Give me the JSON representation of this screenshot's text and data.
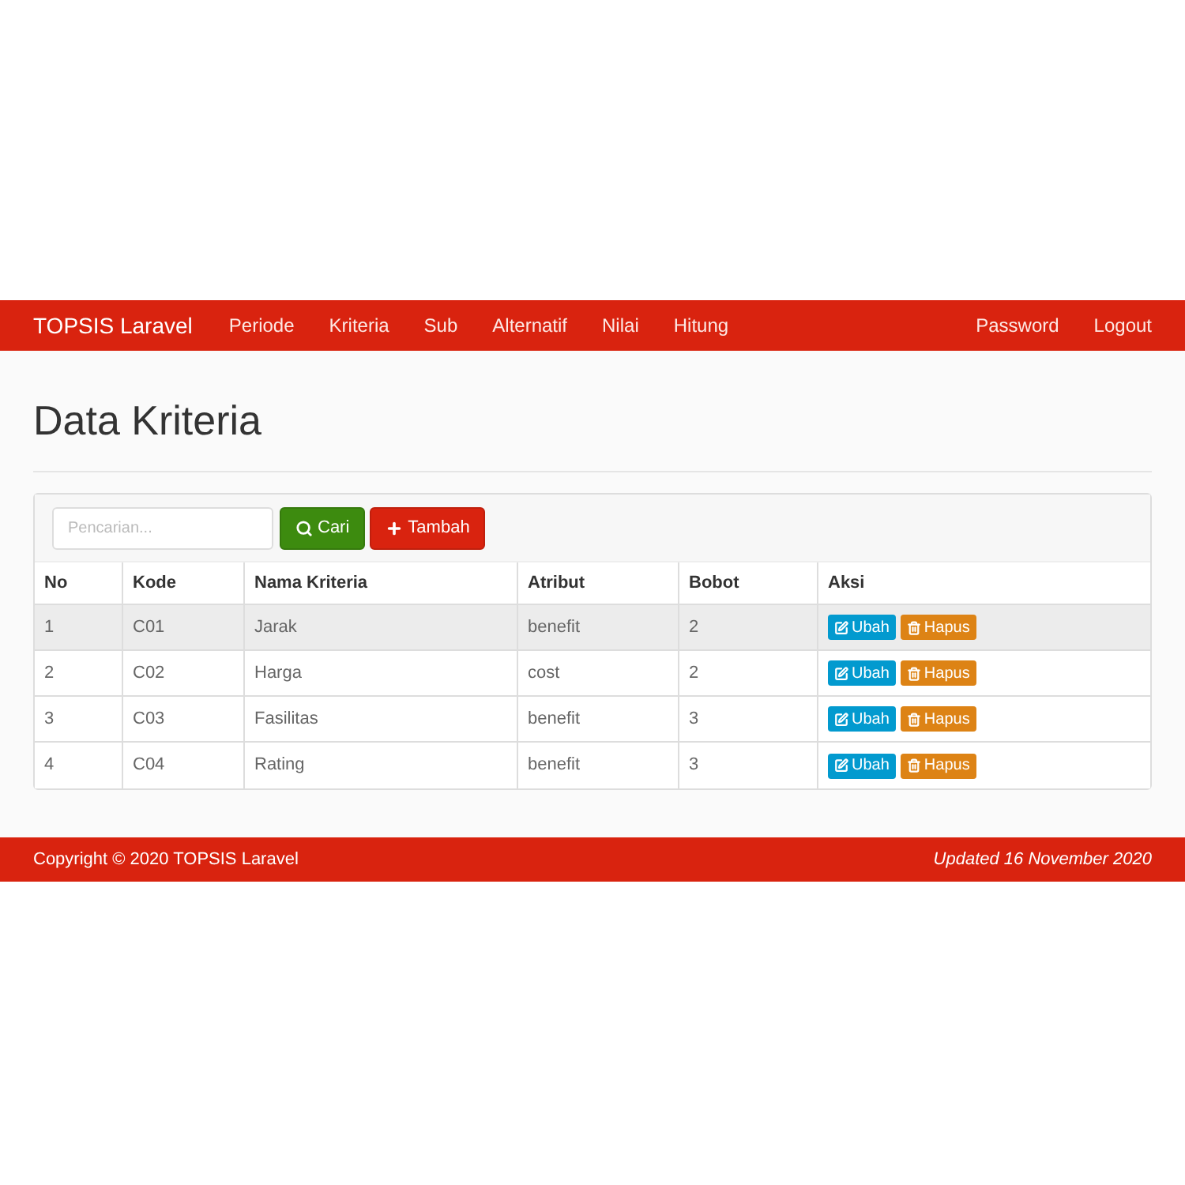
{
  "navbar": {
    "brand": "TOPSIS Laravel",
    "items": [
      "Periode",
      "Kriteria",
      "Sub",
      "Alternatif",
      "Nilai",
      "Hitung"
    ],
    "right_items": [
      "Password",
      "Logout"
    ]
  },
  "page_title": "Data Kriteria",
  "toolbar": {
    "search": {
      "placeholder": "Pencarian..."
    },
    "search_button": "Cari",
    "add_button": "Tambah"
  },
  "table": {
    "columns": [
      "No",
      "Kode",
      "Nama Kriteria",
      "Atribut",
      "Bobot",
      "Aksi"
    ],
    "rows": [
      {
        "cells": [
          "1",
          "C01",
          "Jarak",
          "benefit",
          "2"
        ],
        "highlighted": true,
        "actions": [
          "Ubah",
          "Hapus"
        ]
      },
      {
        "cells": [
          "2",
          "C02",
          "Harga",
          "cost",
          "2"
        ],
        "highlighted": false,
        "actions": [
          "Ubah",
          "Hapus"
        ]
      },
      {
        "cells": [
          "3",
          "C03",
          "Fasilitas",
          "benefit",
          "3"
        ],
        "highlighted": false,
        "actions": [
          "Ubah",
          "Hapus"
        ]
      },
      {
        "cells": [
          "4",
          "C04",
          "Rating",
          "benefit",
          "3"
        ],
        "highlighted": false,
        "actions": [
          "Ubah",
          "Hapus"
        ]
      }
    ]
  },
  "footer": {
    "copyright": "Copyright © 2020 TOPSIS Laravel",
    "updated": "Updated 16 November 2020"
  }
}
